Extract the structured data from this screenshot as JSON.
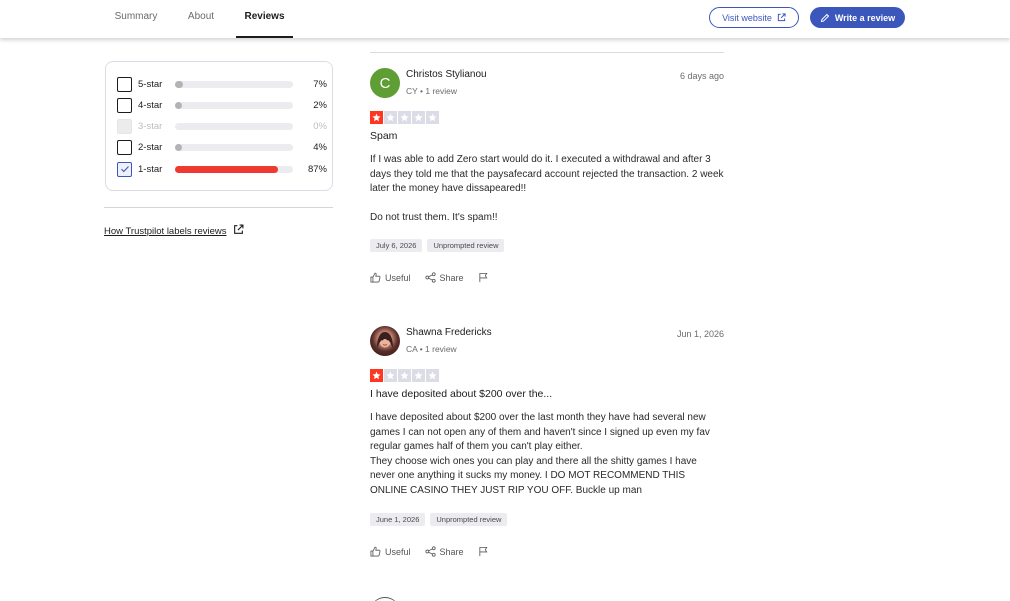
{
  "nav": {
    "tabs": [
      {
        "label": "Summary"
      },
      {
        "label": "About"
      },
      {
        "label": "Reviews"
      }
    ],
    "visit_website": "Visit website",
    "write_review": "Write a review"
  },
  "filter": {
    "rows": [
      {
        "label": "5-star",
        "percent": "7%",
        "fill": 0.07,
        "checked": false,
        "disabled": false
      },
      {
        "label": "4-star",
        "percent": "2%",
        "fill": 0.02,
        "checked": false,
        "disabled": false
      },
      {
        "label": "3-star",
        "percent": "0%",
        "fill": 0.0,
        "checked": false,
        "disabled": true
      },
      {
        "label": "2-star",
        "percent": "4%",
        "fill": 0.04,
        "checked": false,
        "disabled": false
      },
      {
        "label": "1-star",
        "percent": "87%",
        "fill": 0.87,
        "checked": true,
        "disabled": false
      }
    ],
    "labels_link": "How Trustpilot labels reviews"
  },
  "reviews": [
    {
      "initial": "C",
      "name": "Christos Stylianou",
      "meta": "CY • 1 review",
      "date": "6 days ago",
      "rating": 1,
      "title": "Spam",
      "body": [
        "If I was able to add Zero start would do it. I executed a withdrawal and after 3 days they told me that the paysafecard account rejected the transaction. 2 week later the money have dissapeared!!",
        "Do not trust them. It's spam!!"
      ],
      "tags": [
        "July 6, 2026",
        "Unprompted review"
      ],
      "useful": "Useful",
      "share": "Share"
    },
    {
      "name": "Shawna Fredericks",
      "meta": "CA • 1 review",
      "date": "Jun 1, 2026",
      "rating": 1,
      "title": "I have deposited about $200 over the...",
      "body": [
        "I have deposited about $200 over the last month they have had several new games I can not open any of them and haven't since I signed up even my fav regular games half of them you can't play either.",
        "They choose wich ones you can play and there all the shitty games I have never one anything it sucks my money. I DO MOT RECOMMEND THIS ONLINE CASINO THEY JUST RIP YOU OFF. Buckle up man"
      ],
      "tags": [
        "June 1, 2026",
        "Unprompted review"
      ],
      "useful": "Useful",
      "share": "Share"
    }
  ],
  "colors": {
    "brand": "#3c57bc",
    "star_on": "#ff3722",
    "star_off": "#dcdce6",
    "bar_red": "#ef3a32",
    "avatar_green": "#5e9e34"
  }
}
